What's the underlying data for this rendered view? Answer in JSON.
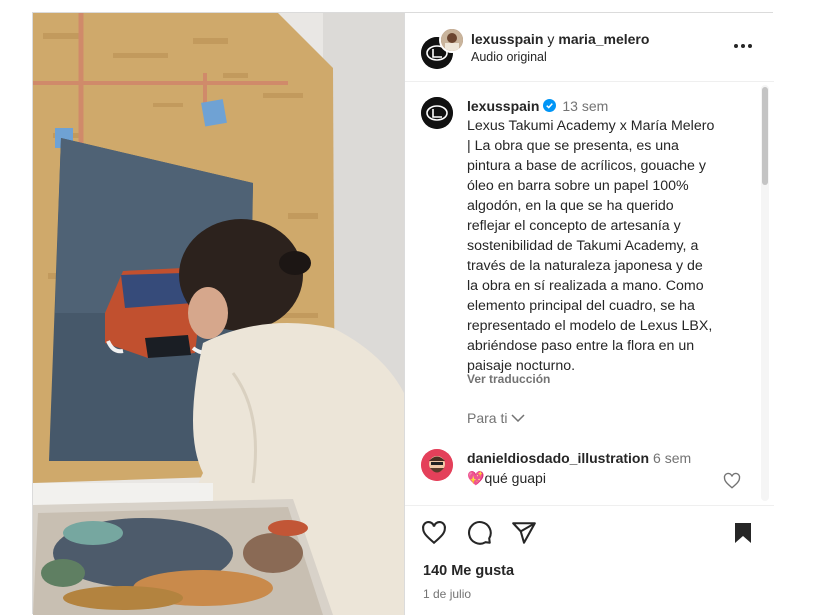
{
  "header": {
    "user1": "lexusspain",
    "separator": "y",
    "user2": "maria_melero",
    "audio": "Audio original",
    "more_icon": "more-horizontal-icon"
  },
  "caption": {
    "username": "lexusspain",
    "time": "13 sem",
    "lines": [
      "Lexus Takumi Academy x María Melero",
      "| La obra que se presenta, es una",
      "pintura a base de acrílicos, gouache y",
      "óleo en barra sobre un papel 100%",
      "algodón, en la que se ha querido",
      "reflejar el concepto de artesanía y",
      "sostenibilidad de Takumi Academy, a",
      "través de la naturaleza japonesa y de",
      "la obra en sí realizada a mano. Como",
      "elemento principal del cuadro, se ha",
      "representado el modelo de Lexus LBX,",
      "abriéndose paso entre la flora en un",
      "paisaje nocturno."
    ],
    "see_translation": "Ver traducción"
  },
  "for_you": "Para ti",
  "comment": {
    "username": "danieldiosdado_illustration",
    "time": "6 sem",
    "text": "qué guapi",
    "emoji": "💖"
  },
  "actions": {
    "likes": "140 Me gusta",
    "date": "1 de julio"
  },
  "colors": {
    "verified": "#0095f6",
    "text": "#262626",
    "secondary": "#737373",
    "border": "#dbdbdb"
  }
}
